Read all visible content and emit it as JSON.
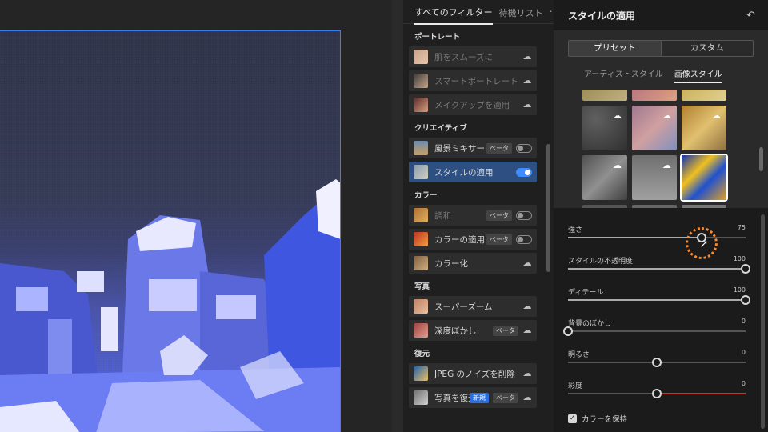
{
  "filters": {
    "tabs": [
      {
        "label": "すべてのフィルター",
        "active": true
      },
      {
        "label": "待機リスト",
        "active": false
      }
    ],
    "more": "⋯",
    "categories": [
      {
        "title": "ポートレート",
        "items": [
          {
            "label": "肌をスムーズに",
            "dim": true
          },
          {
            "label": "スマートポートレート",
            "dim": true
          },
          {
            "label": "メイクアップを適用",
            "dim": true
          }
        ]
      },
      {
        "title": "クリエイティブ",
        "items": [
          {
            "label": "風景ミキサー",
            "badge": "ベータ"
          },
          {
            "label": "スタイルの適用",
            "selected": true
          }
        ]
      },
      {
        "title": "カラー",
        "items": [
          {
            "label": "調和",
            "badge": "ベータ",
            "dim": true
          },
          {
            "label": "カラーの適用",
            "badge": "ベータ"
          },
          {
            "label": "カラー化"
          }
        ]
      },
      {
        "title": "写真",
        "items": [
          {
            "label": "スーパーズーム"
          },
          {
            "label": "深度ぼかし",
            "badge": "ベータ"
          }
        ]
      },
      {
        "title": "復元",
        "items": [
          {
            "label": "JPEG のノイズを削除"
          },
          {
            "label": "写真を復元",
            "badge_new": "新規",
            "badge": "ベータ"
          }
        ]
      }
    ]
  },
  "style": {
    "title": "スタイルの適用",
    "segments": [
      "プリセット",
      "カスタム"
    ],
    "subtabs": [
      "アーティストスタイル",
      "画像スタイル"
    ],
    "sliders": [
      {
        "label": "強さ",
        "value": "75",
        "pct": 0.75
      },
      {
        "label": "スタイルの不透明度",
        "value": "100",
        "pct": 1.0
      },
      {
        "label": "ディテール",
        "value": "100",
        "pct": 1.0
      },
      {
        "label": "背景のぼかし",
        "value": "0",
        "pct": 0.0
      },
      {
        "label": "明るさ",
        "value": "0",
        "pct": 0.5
      },
      {
        "label": "彩度",
        "value": "0",
        "pct": 0.5
      }
    ],
    "checkbox_label": "カラーを保持",
    "colors": {
      "accent": "#3f8cff",
      "selected_item": "#2d4f82",
      "highlight_ring": "#ff8a2b"
    }
  }
}
